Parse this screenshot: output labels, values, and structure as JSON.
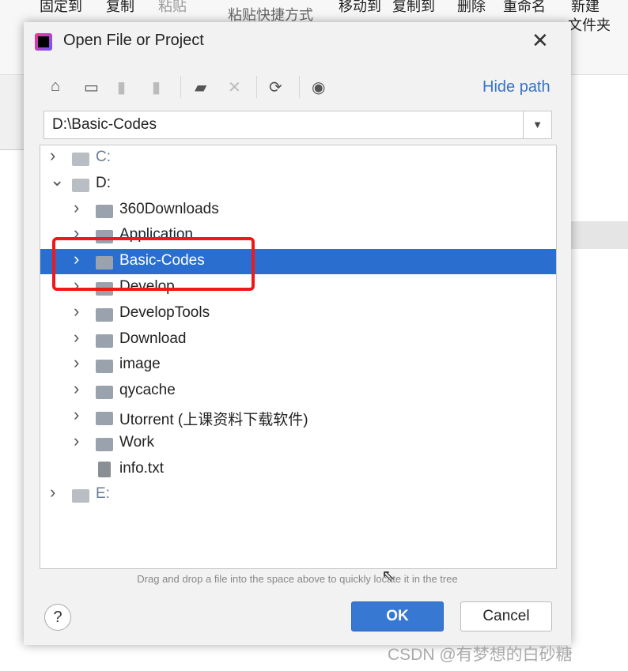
{
  "background_ribbon": {
    "items": [
      "固定到",
      "复制",
      "粘贴",
      "粘贴快捷方式",
      "移动到",
      "复制到",
      "删除",
      "重命名",
      "新建",
      "文件夹"
    ]
  },
  "dialog": {
    "title": "Open File or Project",
    "toolbar": {
      "icons": [
        "home-icon",
        "desktop-icon",
        "project-folder-icon",
        "module-folder-icon",
        "new-folder-icon",
        "delete-icon",
        "refresh-icon",
        "show-hidden-icon"
      ],
      "hide_path": "Hide path"
    },
    "path": "D:\\Basic-Codes",
    "tree": [
      {
        "label": "C:",
        "type": "drive",
        "expanded": false,
        "depth": 0
      },
      {
        "label": "D:",
        "type": "drive",
        "expanded": true,
        "depth": 0
      },
      {
        "label": "360Downloads",
        "type": "folder",
        "depth": 1
      },
      {
        "label": "Application",
        "type": "folder",
        "depth": 1
      },
      {
        "label": "Basic-Codes",
        "type": "folder",
        "depth": 1,
        "selected": true
      },
      {
        "label": "Develop",
        "type": "folder",
        "depth": 1
      },
      {
        "label": "DevelopTools",
        "type": "folder",
        "depth": 1
      },
      {
        "label": "Download",
        "type": "folder",
        "depth": 1
      },
      {
        "label": "image",
        "type": "folder",
        "depth": 1
      },
      {
        "label": "qycache",
        "type": "folder",
        "depth": 1
      },
      {
        "label": "Utorrent (上课资料下载软件)",
        "type": "folder",
        "depth": 1
      },
      {
        "label": "Work",
        "type": "folder",
        "depth": 1
      },
      {
        "label": "info.txt",
        "type": "file",
        "depth": 1
      },
      {
        "label": "E:",
        "type": "drive",
        "expanded": false,
        "depth": 0
      }
    ],
    "hint": "Drag and drop a file into the space above to quickly locate it in the tree",
    "help": "?",
    "ok": "OK",
    "cancel": "Cancel"
  },
  "watermark": "CSDN @有梦想的白砂糖",
  "colors": {
    "selection": "#2a6fcf",
    "link": "#3574c8",
    "highlight_box": "#f01818"
  }
}
